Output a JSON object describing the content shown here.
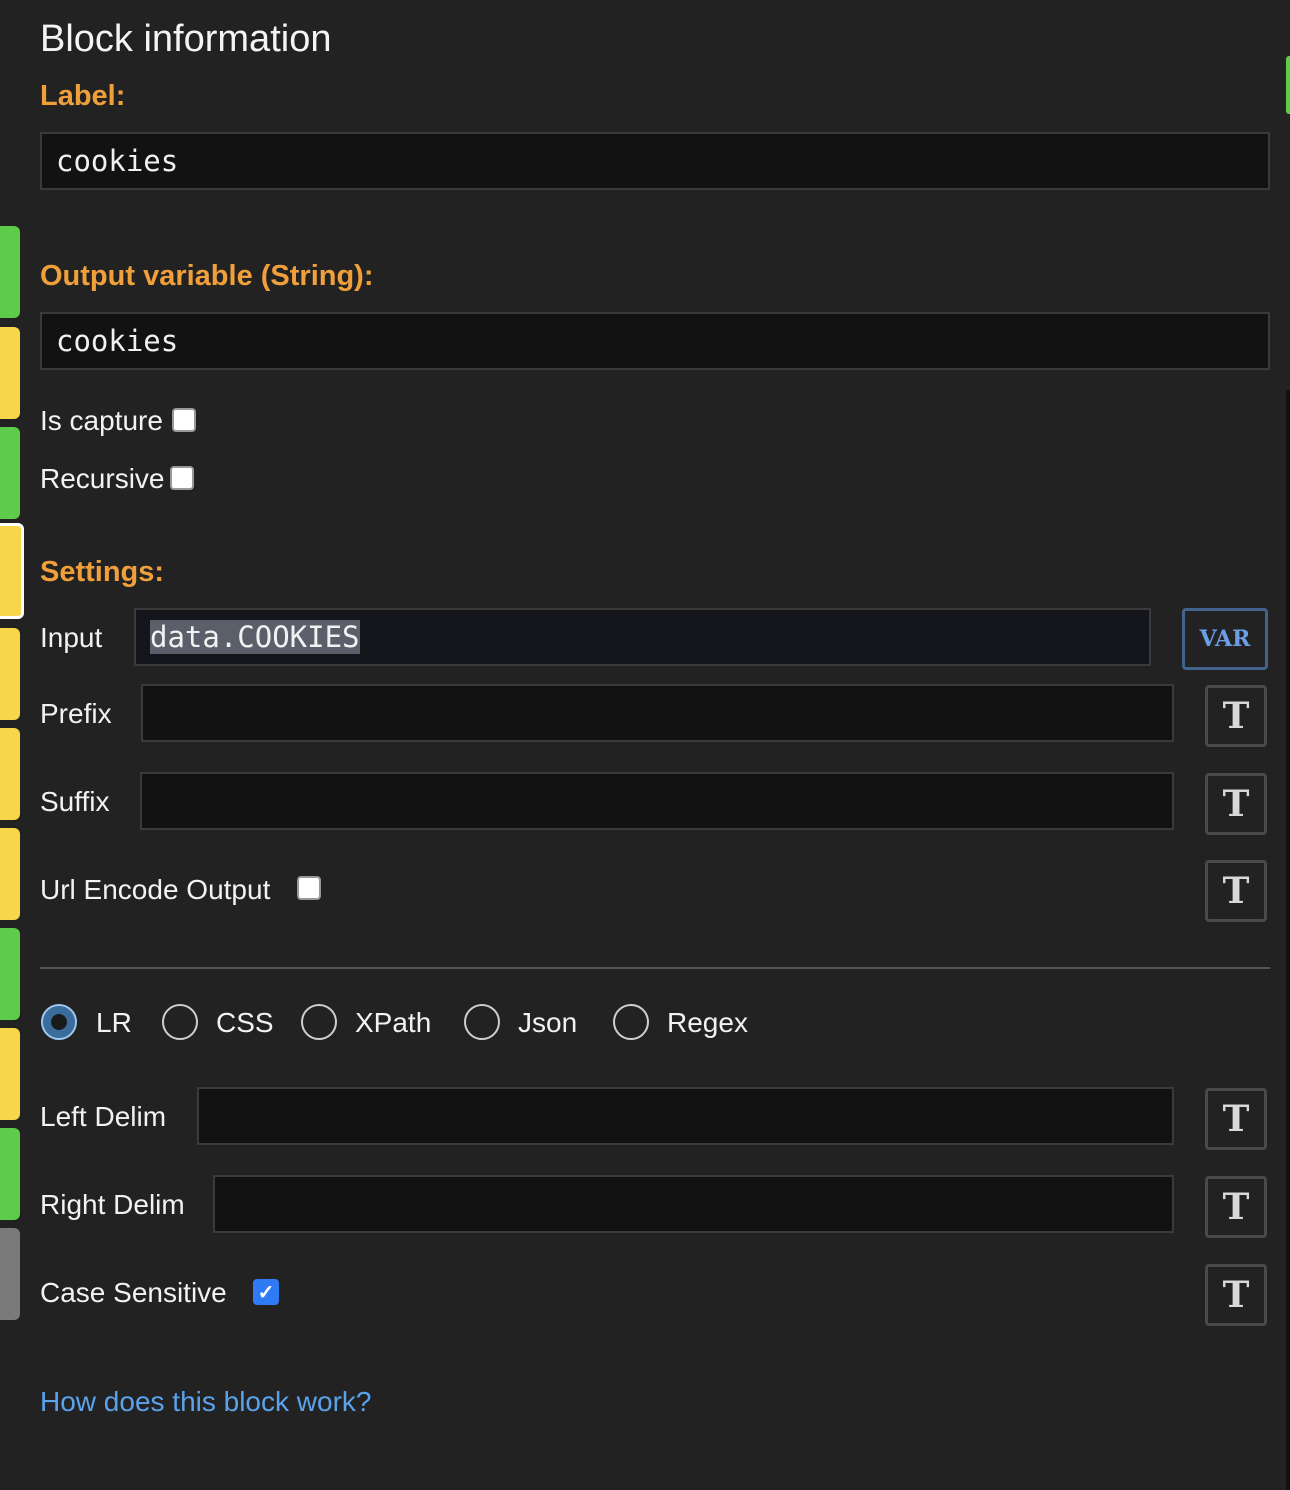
{
  "header": {
    "title": "Block information"
  },
  "label_section": {
    "heading": "Label:",
    "value": "cookies"
  },
  "output_section": {
    "heading": "Output variable (String):",
    "value": "cookies",
    "is_capture_label": "Is capture",
    "is_capture_checked": false,
    "recursive_label": "Recursive",
    "recursive_checked": false
  },
  "settings": {
    "heading": "Settings:",
    "input_label": "Input",
    "input_value": "data.COOKIES",
    "var_button": "VAR",
    "prefix_label": "Prefix",
    "prefix_value": "",
    "suffix_label": "Suffix",
    "suffix_value": "",
    "url_encode_label": "Url Encode Output",
    "url_encode_checked": false,
    "type_button": "T"
  },
  "parser_modes": {
    "options": [
      "LR",
      "CSS",
      "XPath",
      "Json",
      "Regex"
    ],
    "selected": "LR"
  },
  "delims": {
    "left_label": "Left Delim",
    "left_value": "",
    "right_label": "Right Delim",
    "right_value": "",
    "case_label": "Case Sensitive",
    "case_checked": true
  },
  "help_link": "How does this block work?",
  "colors": {
    "background": "#222222",
    "section_heading": "#f0a03a",
    "link": "#5aa3ec",
    "strip_green": "#5ecb4a",
    "strip_yellow": "#f7d64a",
    "strip_gray": "#7a7a7a"
  }
}
